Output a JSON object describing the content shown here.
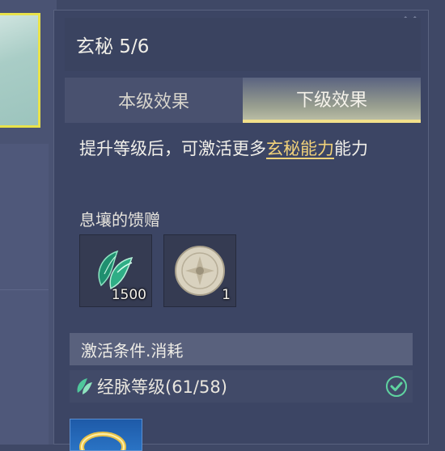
{
  "panel": {
    "title": "玄秘 5/6"
  },
  "tabs": [
    {
      "label": "本级效果",
      "active": false
    },
    {
      "label": "下级效果",
      "active": true
    }
  ],
  "description": {
    "before": "提升等级后，可激活更多",
    "highlight": "玄秘能力",
    "after": "能力"
  },
  "rewards": {
    "title": "息壤的馈赠",
    "items": [
      {
        "icon": "jade-leaf-icon",
        "count": "1500"
      },
      {
        "icon": "jade-disc-icon",
        "count": "1"
      }
    ]
  },
  "conditions": {
    "header": "激活条件.消耗",
    "rows": [
      {
        "icon": "meridian-leaf-icon",
        "label": "经脉等级(61/58)",
        "met": true
      }
    ]
  },
  "colors": {
    "highlight": "#f2d27a",
    "check": "#5fd3a0",
    "panel_bg": "#3c4564",
    "tab_active_underline": "#f3e08a"
  }
}
